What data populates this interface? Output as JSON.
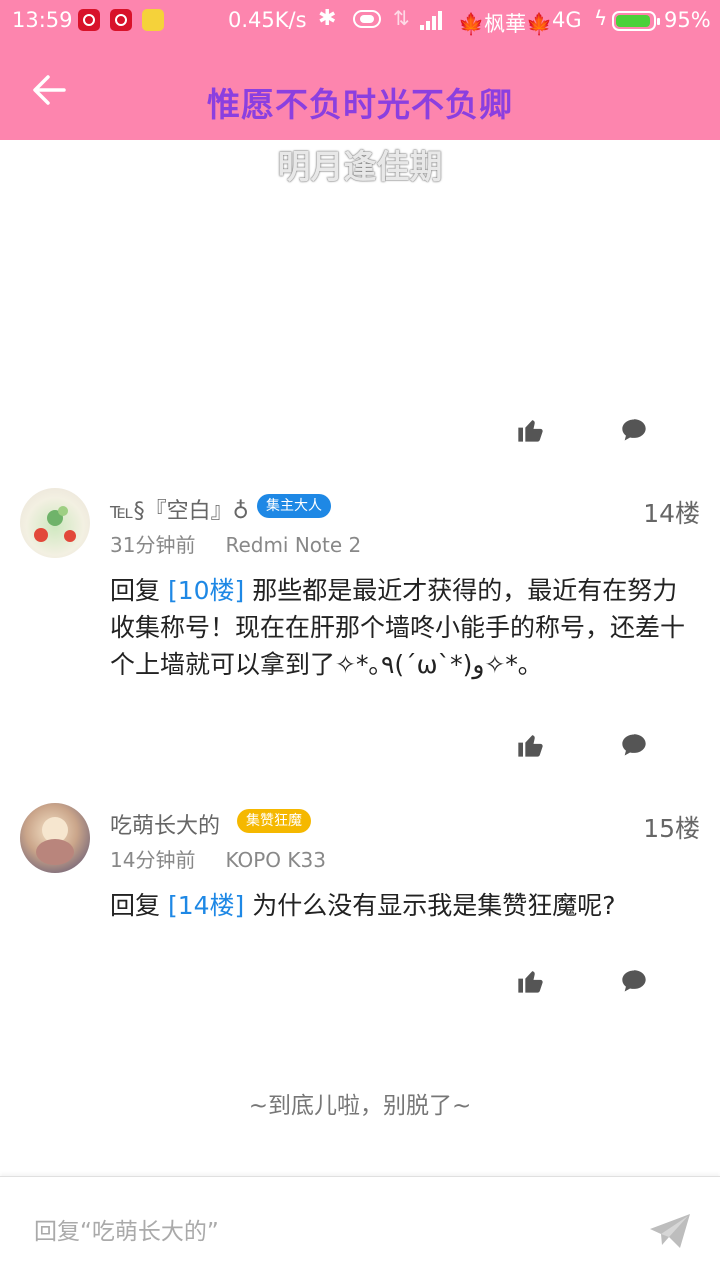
{
  "status_bar": {
    "time": "13:59",
    "speed": "0.45K/s",
    "carrier": "🍁枫華🍁",
    "network": "4G",
    "battery_pct": "95%",
    "battery_level": 0.95
  },
  "toolbar": {
    "title": "惟愿不负时光不负卿"
  },
  "post": {
    "subtitle": "明月逢佳期"
  },
  "comments": [
    {
      "username": "℡§『空白』♁",
      "badge": "集主大人",
      "floor": "14楼",
      "time": "31分钟前",
      "device": "Redmi Note 2",
      "reply_prefix": "回复 ",
      "reply_ref": "[10楼]",
      "text": " 那些都是最近才获得的，最近有在努力收集称号！现在在肝那个墙咚小能手的称号，还差十个上墙就可以拿到了✧*｡٩(ˊωˋ*)و✧*｡"
    },
    {
      "username": "吃萌长大的",
      "badge": "集赞狂魔",
      "floor": "15楼",
      "time": "14分钟前",
      "device": "KOPO K33",
      "reply_prefix": "回复 ",
      "reply_ref": "[14楼]",
      "text": " 为什么没有显示我是集赞狂魔呢?"
    }
  ],
  "footer": {
    "end_text": "~到底儿啦，别脱了~"
  },
  "reply_bar": {
    "placeholder": "回复“吃萌长大的”"
  },
  "colors": {
    "toolbar_bg": "#fd85ae",
    "title": "#8b3fe0",
    "link": "#1e88e5",
    "badge_blue": "#1e88e5",
    "badge_gold": "#f5b800"
  },
  "icons": [
    "back-arrow-icon",
    "thumbs-up-icon",
    "comment-bubble-icon",
    "send-icon",
    "bluetooth-icon",
    "battery-icon",
    "signal-icon"
  ]
}
